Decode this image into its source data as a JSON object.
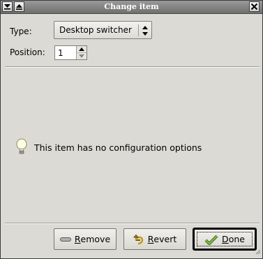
{
  "window": {
    "title": "Change item"
  },
  "form": {
    "type_label": "Type:",
    "type_value": "Desktop switcher",
    "position_label": "Position:",
    "position_value": "1"
  },
  "info": {
    "message": "This item has no configuration options"
  },
  "buttons": {
    "remove_first": "R",
    "remove_rest": "emove",
    "revert_first": "R",
    "revert_rest": "evert",
    "done_first": "D",
    "done_rest": "one"
  },
  "icons": {
    "menu": "window-menu-icon",
    "shade": "shade-icon",
    "close": "close-icon",
    "bulb": "lightbulb-icon",
    "remove": "remove-icon",
    "revert": "revert-icon",
    "done": "done-icon"
  }
}
